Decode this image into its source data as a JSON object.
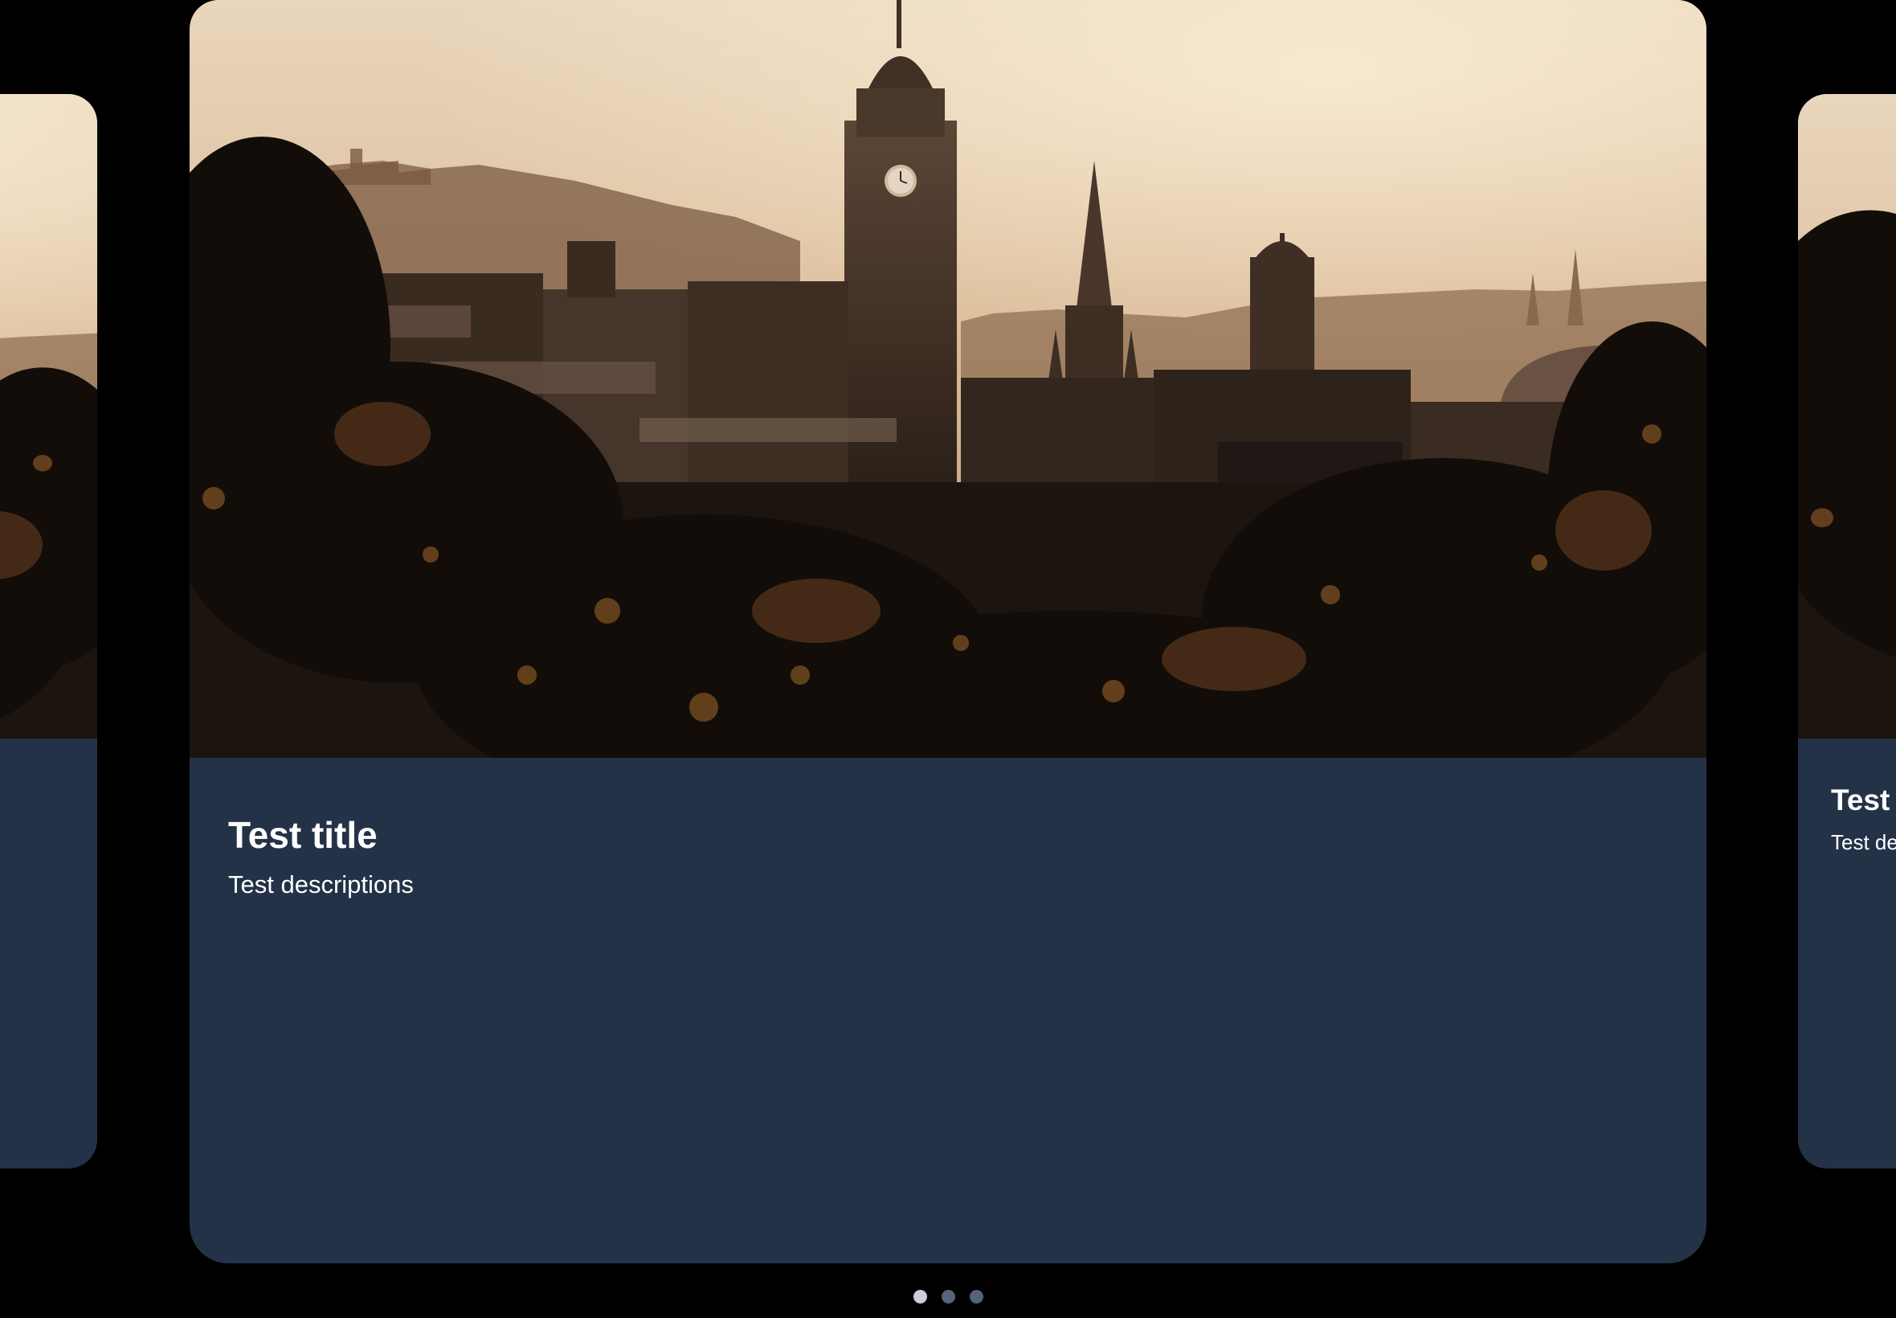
{
  "carousel": {
    "active_index": 0,
    "cards": [
      {
        "position": "left",
        "title": "",
        "description": ""
      },
      {
        "position": "center",
        "title": "Test title",
        "description": "Test descriptions"
      },
      {
        "position": "right",
        "title": "Test",
        "description": "Test de"
      }
    ],
    "pager_count": 3
  },
  "image": {
    "subject": "city skyline at sunset with clock tower, gothic spire, domed building and foliage in foreground",
    "palette": {
      "sky_top": "#e6d2b8",
      "sky_bottom": "#c9a27c",
      "buildings": "#4a382b",
      "buildings_dark": "#2a1f17",
      "foliage": "#1a120c",
      "foliage_highlight": "#a4692b"
    }
  },
  "colors": {
    "background": "#000000",
    "card": "#243247",
    "text": "#ffffff",
    "dot_active": "#c9ced8",
    "dot_inactive": "#566379"
  }
}
